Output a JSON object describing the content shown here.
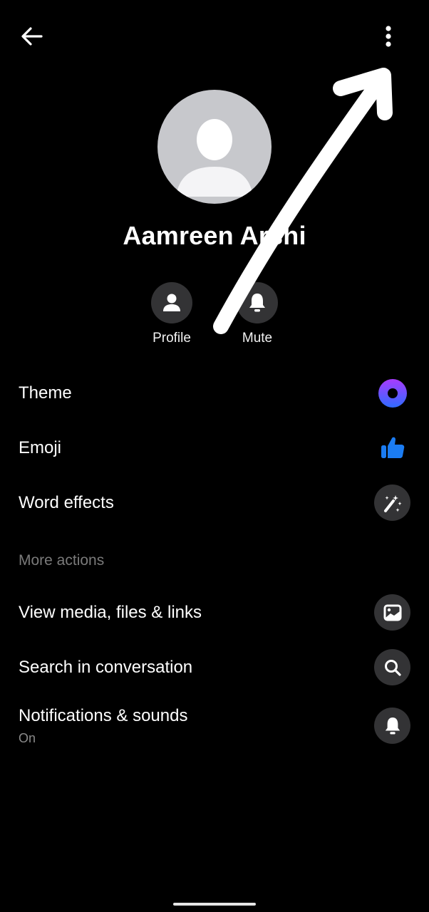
{
  "header": {
    "back_icon": "arrow-left-icon",
    "more_icon": "more-vertical-icon"
  },
  "contact": {
    "name": "Aamreen Arshi",
    "avatar_icon": "default-avatar-icon"
  },
  "quick_actions": [
    {
      "label": "Profile",
      "icon": "person-icon"
    },
    {
      "label": "Mute",
      "icon": "bell-icon"
    }
  ],
  "settings": [
    {
      "label": "Theme",
      "icon": "theme-ring-icon"
    },
    {
      "label": "Emoji",
      "icon": "thumbs-up-icon"
    },
    {
      "label": "Word effects",
      "icon": "magic-wand-icon"
    }
  ],
  "more_actions": {
    "heading": "More actions",
    "items": [
      {
        "label": "View media, files & links",
        "icon": "image-icon"
      },
      {
        "label": "Search in conversation",
        "icon": "search-icon"
      },
      {
        "label": "Notifications & sounds",
        "sublabel": "On",
        "icon": "bell-icon"
      }
    ]
  },
  "colors": {
    "background": "#000000",
    "icon_circle": "#333335",
    "avatar_bg": "#c7c8cc",
    "theme_gradient_start": "#a93bff",
    "theme_gradient_end": "#2f6bff",
    "emoji_blue": "#1b7cf2",
    "muted_text": "#7a7a7a"
  },
  "annotation": {
    "type": "hand-drawn-arrow",
    "points_to": "more-options-button",
    "color": "#ffffff"
  }
}
